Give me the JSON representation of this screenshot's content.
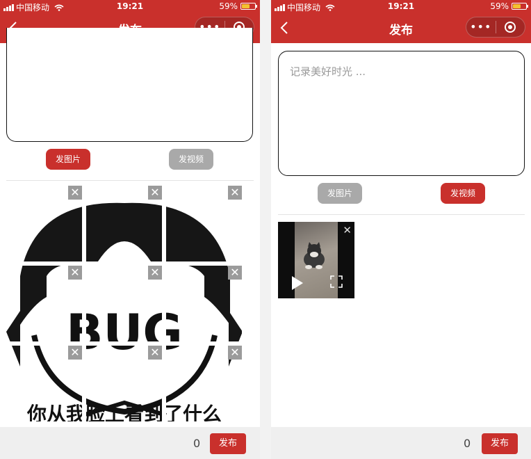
{
  "status": {
    "carrier": "中国移动",
    "time": "19:21",
    "battery": "59%",
    "battery_level": 0.59
  },
  "nav": {
    "title": "发布",
    "more": "•••"
  },
  "left": {
    "btn_image": "发图片",
    "btn_video": "发视频",
    "meme_text": "BUG",
    "meme_caption": "你从我脸上看到了什么",
    "count": "0",
    "publish": "发布"
  },
  "right": {
    "placeholder": "记录美好时光 ...",
    "btn_image": "发图片",
    "btn_video": "发视频",
    "count": "0",
    "publish": "发布"
  },
  "colors": {
    "accent": "#c9302c",
    "disabled": "#a9a9a9"
  },
  "icons": [
    "back-icon",
    "more-icon",
    "close-circle-icon",
    "remove-icon",
    "play-icon",
    "fullscreen-icon"
  ]
}
